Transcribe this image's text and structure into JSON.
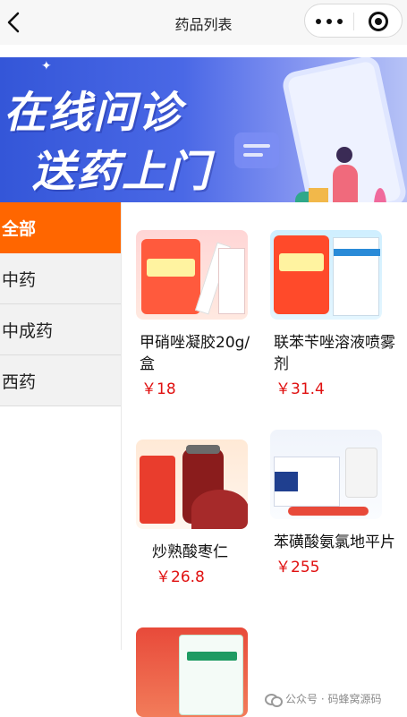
{
  "navbar": {
    "title": "药品列表",
    "back_icon": "chevron-left-icon",
    "menu_icon": "more-dots-icon",
    "close_icon": "target-circle-icon"
  },
  "banner": {
    "line1": "在线问诊",
    "line2": "送药上门"
  },
  "categories": [
    {
      "label": "全部",
      "active": true
    },
    {
      "label": "中药",
      "active": false
    },
    {
      "label": "中成药",
      "active": false
    },
    {
      "label": "西药",
      "active": false
    }
  ],
  "products": [
    {
      "name": "甲硝唑凝胶20g/盒",
      "price": "￥18"
    },
    {
      "name": "联苯苄唑溶液喷雾剂",
      "price": "￥31.4"
    },
    {
      "name": "炒熟酸枣仁",
      "price": "￥26.8"
    },
    {
      "name": "苯磺酸氨氯地平片",
      "price": "￥255"
    },
    {
      "name": "",
      "price": ""
    }
  ],
  "watermark": {
    "text": "公众号 · 码蜂窝源码"
  },
  "colors": {
    "accent": "#ff6600",
    "price": "#e01010",
    "banner": "#4a68e6"
  }
}
